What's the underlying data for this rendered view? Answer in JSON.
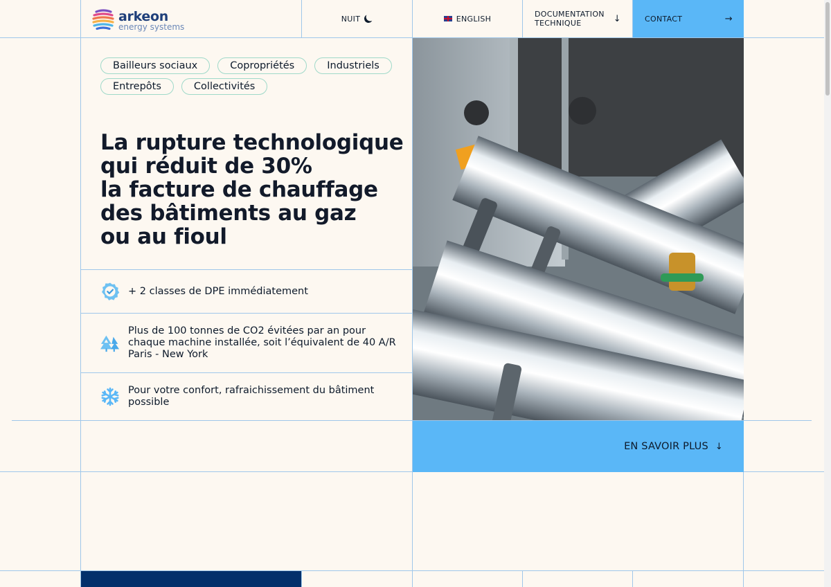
{
  "header": {
    "logo_brand": "arkeon",
    "logo_sub": "energy systems",
    "nav": {
      "night_label": "NUIT",
      "lang_label": "ENGLISH",
      "doc_label_line1": "DOCUMENTATION",
      "doc_label_line2": "TECHNIQUE",
      "contact_label": "CONTACT"
    }
  },
  "tags": {
    "row1": [
      "Bailleurs sociaux",
      "Copropriétés",
      "Industriels"
    ],
    "row2": [
      "Entrepôts",
      "Collectivités"
    ]
  },
  "headline": {
    "lines": [
      "La rupture technologique",
      "qui réduit de 30%",
      "la facture de chauffage",
      "des bâtiments au gaz",
      "ou au fioul"
    ]
  },
  "features": [
    {
      "icon": "badge-check-icon",
      "text": "+ 2 classes de DPE immédiatement"
    },
    {
      "icon": "trees-icon",
      "text": "Plus de 100 tonnes de CO2 évitées par an pour chaque machine installée, soit l’équivalent de 40 A/R Paris - New York"
    },
    {
      "icon": "snowflake-icon",
      "text": "Pour votre confort, rafraichissement du bâtiment possible"
    }
  ],
  "cta": {
    "label": "EN SAVOIR PLUS"
  },
  "colors": {
    "background": "#fdf8f1",
    "accent_blue": "#5ab7f7",
    "grid_line": "#9fc7ea",
    "navy": "#03306b",
    "tag_border": "#9fd9c9"
  }
}
